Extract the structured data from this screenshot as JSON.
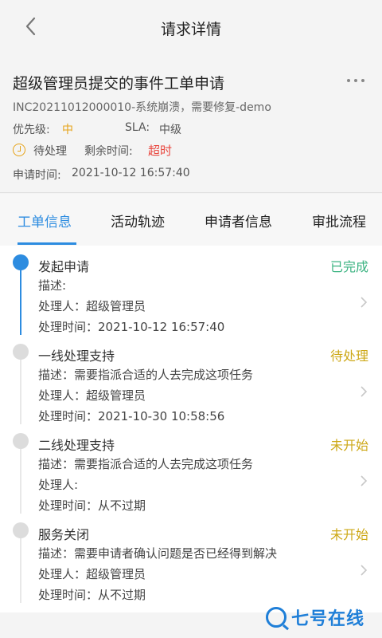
{
  "header": {
    "title": "请求详情",
    "back_icon": "chevron-left-icon"
  },
  "summary": {
    "title": "超级管理员提交的事件工单申请",
    "subtitle": "INC20211012000010-系统崩溃，需要修复-demo",
    "priority_label": "优先级:",
    "priority_value": "中",
    "sla_label": "SLA:",
    "sla_value": "中级",
    "status_value": "待处理",
    "remaining_label": "剩余时间:",
    "remaining_value": "超时",
    "apply_time_label": "申请时间:",
    "apply_time_value": "2021-10-12 16:57:40",
    "colors": {
      "priority": "#e6a317",
      "overdue": "#e9473f",
      "accent": "#2d8ce0"
    }
  },
  "tabs": [
    {
      "label": "工单信息",
      "active": true
    },
    {
      "label": "活动轨迹",
      "active": false
    },
    {
      "label": "申请者信息",
      "active": false
    },
    {
      "label": "审批流程",
      "active": false
    }
  ],
  "steps": [
    {
      "name": "发起申请",
      "status": "已完成",
      "desc": "描述:",
      "handler": "处理人：超级管理员",
      "time": "处理时间：2021-10-12 16:57:40"
    },
    {
      "name": "一线处理支持",
      "status": "待处理",
      "desc": "描述：需要指派合适的人去完成这项任务",
      "handler": "处理人：超级管理员",
      "time": "处理时间：2021-10-30 10:58:56"
    },
    {
      "name": "二线处理支持",
      "status": "未开始",
      "desc": "描述：需要指派合适的人去完成这项任务",
      "handler": "处理人:",
      "time": "处理时间：从不过期"
    },
    {
      "name": "服务关闭",
      "status": "未开始",
      "desc": "描述：需要申请者确认问题是否已经得到解决",
      "handler": "处理人：超级管理员",
      "time": "处理时间：从不过期"
    }
  ],
  "watermark": {
    "text": "七号在线"
  }
}
